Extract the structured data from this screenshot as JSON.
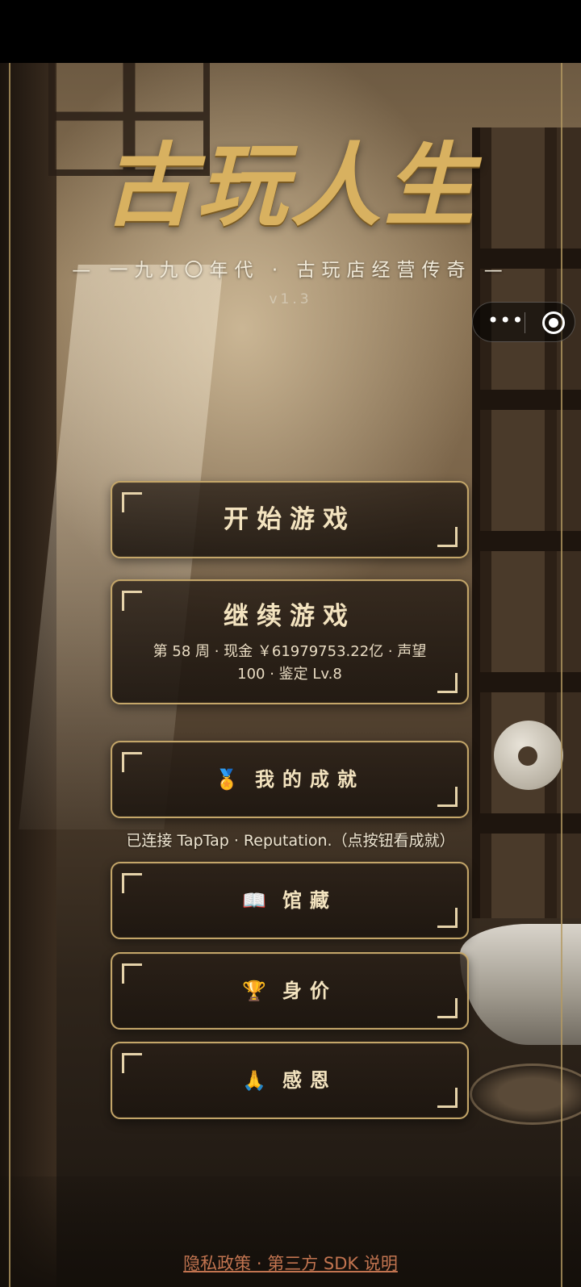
{
  "game": {
    "title": "古玩人生",
    "subtitle": "— 一九九〇年代 · 古玩店经营传奇 —",
    "version": "v1.3"
  },
  "capsule": {
    "more_icon": "more-dots-icon",
    "close_icon": "target-circle-icon",
    "more_glyph": "•••"
  },
  "menu": {
    "start": {
      "label": "开始游戏"
    },
    "continue": {
      "label": "继续游戏",
      "detail": "第 58 周 · 现金 ￥61979753.22亿 · 声望 100 · 鉴定 Lv.8"
    },
    "achievements": {
      "icon": "🏅",
      "label": "我的成就"
    },
    "achievements_note": "已连接 TapTap · Reputation.（点按钮看成就）",
    "collection": {
      "icon": "📖",
      "label": "馆藏"
    },
    "net_worth": {
      "icon": "🏆",
      "label": "身价"
    },
    "thanks": {
      "icon": "🙏",
      "label": "感恩"
    }
  },
  "footer": {
    "privacy_link": "隐私政策 · 第三方 SDK 说明"
  },
  "colors": {
    "gold_border": "#c4a669",
    "title_gold": "#d8b160",
    "link_color": "#c27450"
  }
}
